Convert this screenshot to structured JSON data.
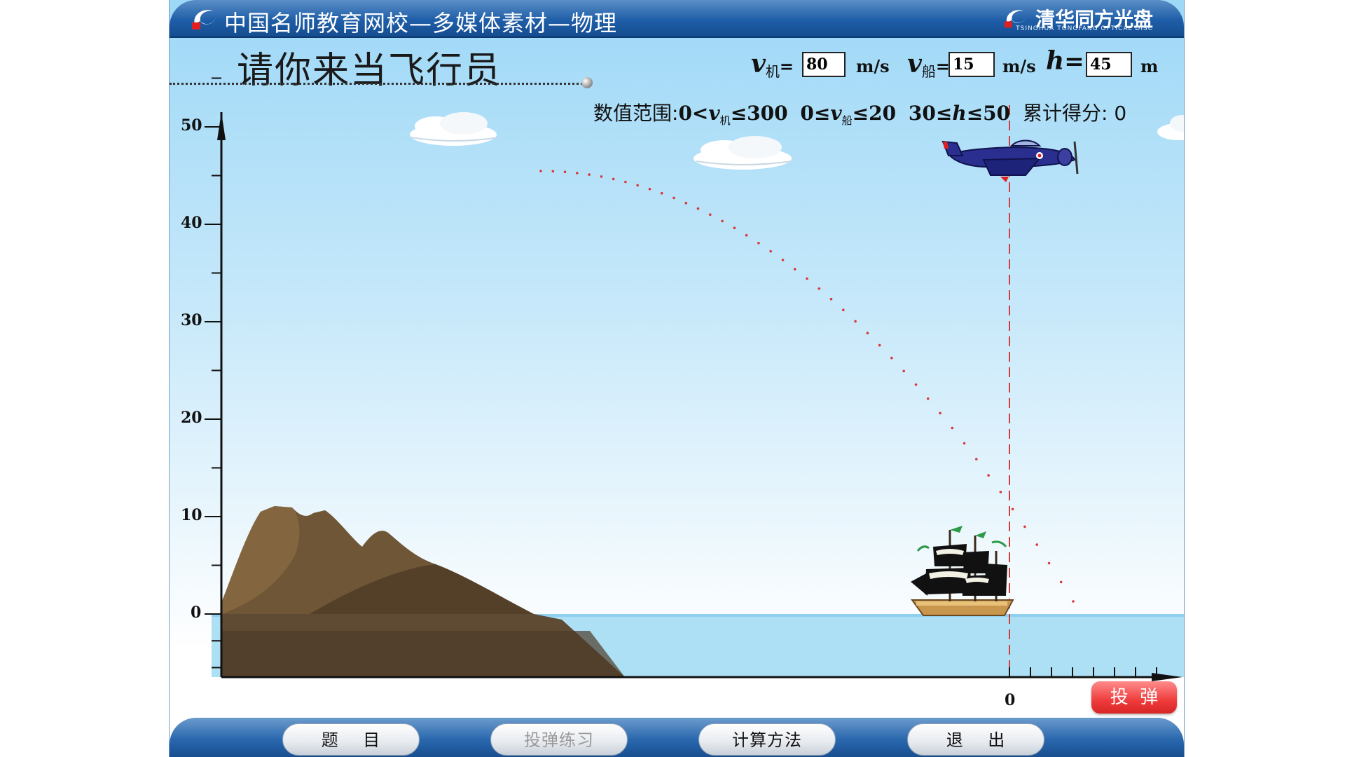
{
  "header": {
    "title": "中国名师教育网校—多媒体素材—物理",
    "brand": "清华同方光盘",
    "brand_sub": "TSINGHUA TONGFANG OPTICAL DISC"
  },
  "page": {
    "heading": "请你来当飞行员"
  },
  "params": {
    "plane_speed": {
      "symbol": "v",
      "sub": "机",
      "eq": "=",
      "value": "80",
      "unit": "m/s"
    },
    "ship_speed": {
      "symbol": "v",
      "sub": "船",
      "eq": "=",
      "value": "15",
      "unit": "m/s"
    },
    "height": {
      "symbol": "h",
      "eq": "=",
      "value": "45",
      "unit": "m"
    }
  },
  "range_info": {
    "label": "数值范围:",
    "r1_a": "0<",
    "r1_var": "v",
    "r1_sub": "机",
    "r1_b": "≤300",
    "r2_a": "0≤",
    "r2_var": "v",
    "r2_sub": "船",
    "r2_b": "≤20",
    "r3_a": "30≤",
    "r3_var": "h",
    "r3_b": "≤50",
    "score_label": "累计得分:",
    "score": "0"
  },
  "axis": {
    "y_ticks": [
      "50",
      "40",
      "30",
      "20",
      "10",
      "0"
    ],
    "x_origin_label": "0"
  },
  "actions": {
    "drop_label": "投  弹"
  },
  "footer": {
    "buttons": [
      {
        "label": "题    目"
      },
      {
        "label": "投弹练习"
      },
      {
        "label": "计算方法"
      },
      {
        "label": "退    出"
      }
    ]
  },
  "colors": {
    "title_bar": "#1f5ea8",
    "sky_top": "#9ed8f7",
    "sea": "#a8dcf2",
    "trajectory": "#e03030",
    "drop_button": "#ef3b3b",
    "plane": "#2a2f8f"
  },
  "icons": {
    "app_logo": "swirl-logo-icon",
    "brand_logo": "swirl-logo-icon",
    "plane": "airplane-icon",
    "ship": "sailing-ship-icon",
    "cloud": "cloud-icon",
    "mountain": "mountain-icon"
  }
}
